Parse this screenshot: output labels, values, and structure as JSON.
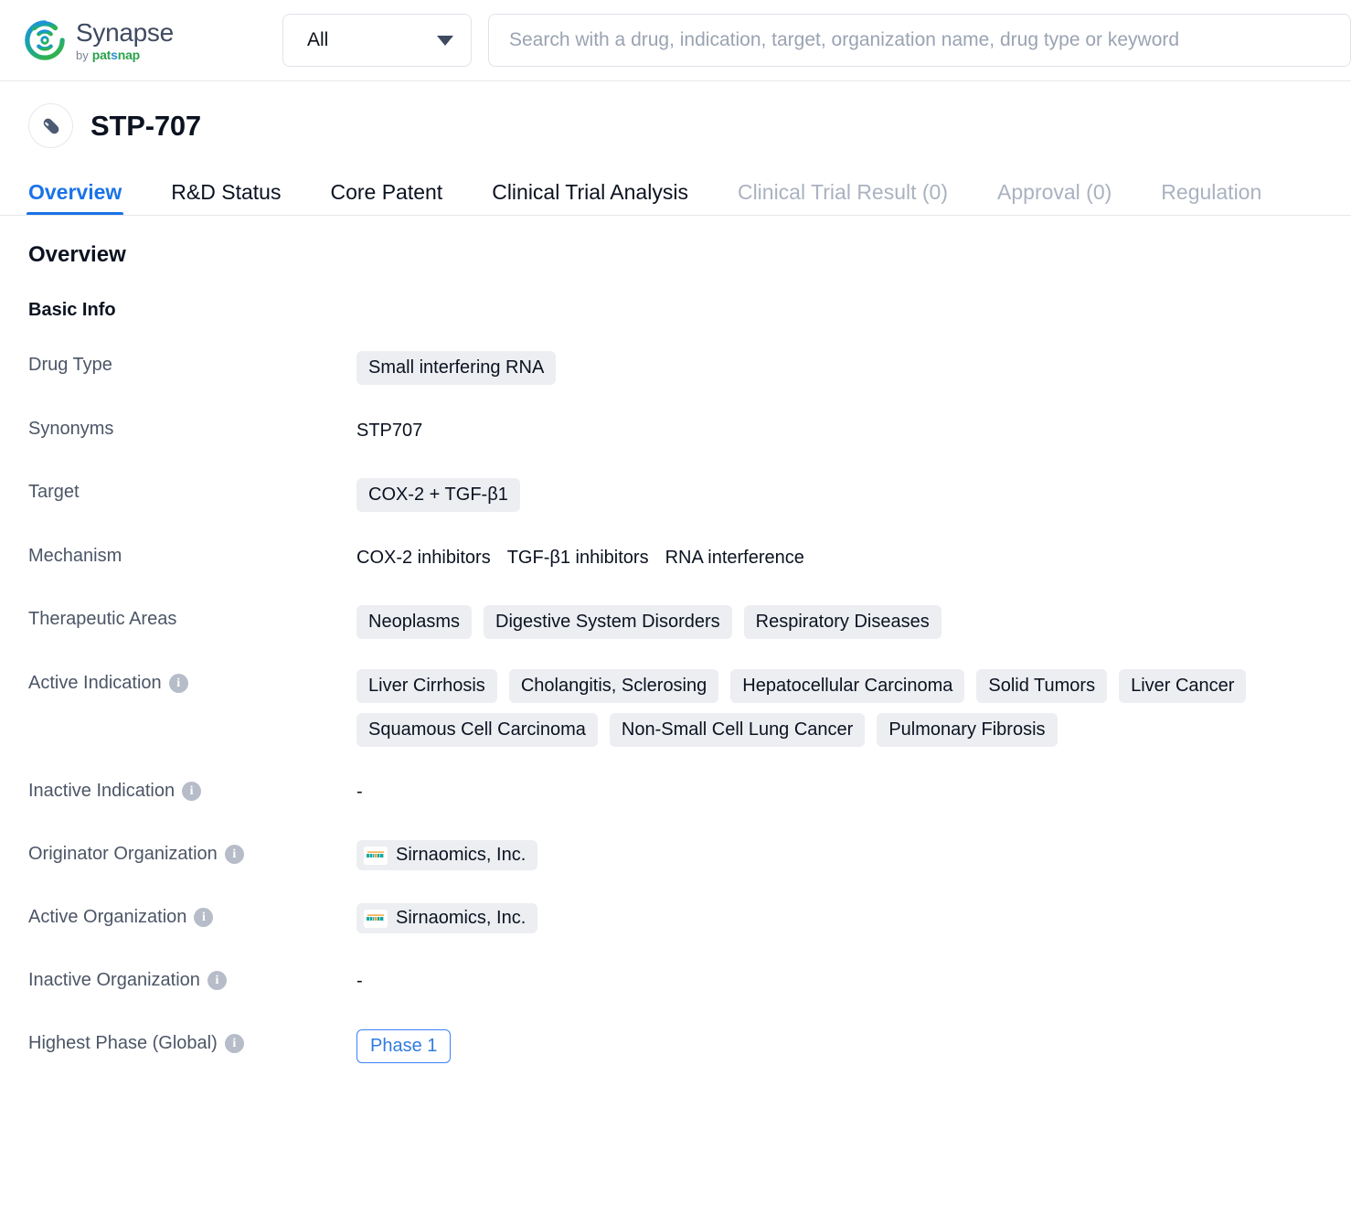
{
  "brand": {
    "name": "Synapse",
    "by": "by",
    "patsnap_a": "pat",
    "patsnap_b": "s",
    "patsnap_c": "nap",
    "logo_icon": "synapse-circular-logo"
  },
  "search": {
    "scope_label": "All",
    "scope_caret_icon": "chevron-down-icon",
    "placeholder": "Search with a drug, indication, target, organization name, drug type or keyword",
    "value": ""
  },
  "drug": {
    "icon": "pill-capsule-icon",
    "name": "STP-707"
  },
  "tabs": [
    {
      "label": "Overview",
      "state": "active"
    },
    {
      "label": "R&D Status",
      "state": "normal"
    },
    {
      "label": "Core Patent",
      "state": "normal"
    },
    {
      "label": "Clinical Trial Analysis",
      "state": "normal"
    },
    {
      "label": "Clinical Trial Result (0)",
      "state": "dim"
    },
    {
      "label": "Approval (0)",
      "state": "dim"
    },
    {
      "label": "Regulation",
      "state": "dim"
    }
  ],
  "overview": {
    "section_title": "Overview",
    "subsection_title": "Basic Info",
    "rows": {
      "drug_type": {
        "label": "Drug Type",
        "chips": [
          "Small interfering RNA"
        ]
      },
      "synonyms": {
        "label": "Synonyms",
        "text": "STP707"
      },
      "target": {
        "label": "Target",
        "chips": [
          "COX-2 + TGF-β1"
        ]
      },
      "mechanism": {
        "label": "Mechanism",
        "items": [
          "COX-2 inhibitors",
          "TGF-β1 inhibitors",
          "RNA interference"
        ]
      },
      "therapeutic_areas": {
        "label": "Therapeutic Areas",
        "chips": [
          "Neoplasms",
          "Digestive System Disorders",
          "Respiratory Diseases"
        ]
      },
      "active_indication": {
        "label": "Active Indication",
        "info_icon": "info-icon",
        "chips": [
          "Liver Cirrhosis",
          "Cholangitis, Sclerosing",
          "Hepatocellular Carcinoma",
          "Solid Tumors",
          "Liver Cancer",
          "Squamous Cell Carcinoma",
          "Non-Small Cell Lung Cancer",
          "Pulmonary Fibrosis"
        ]
      },
      "inactive_indication": {
        "label": "Inactive Indication",
        "info_icon": "info-icon",
        "text": "-"
      },
      "originator_organization": {
        "label": "Originator Organization",
        "info_icon": "info-icon",
        "org_name": "Sirnaomics, Inc.",
        "org_logo_icon": "sirnaomics-logo"
      },
      "active_organization": {
        "label": "Active Organization",
        "info_icon": "info-icon",
        "org_name": "Sirnaomics, Inc.",
        "org_logo_icon": "sirnaomics-logo"
      },
      "inactive_organization": {
        "label": "Inactive Organization",
        "info_icon": "info-icon",
        "text": "-"
      },
      "highest_phase": {
        "label": "Highest Phase (Global)",
        "info_icon": "info-icon",
        "badge": "Phase 1"
      }
    }
  },
  "colors": {
    "accent_blue": "#1a73e8",
    "chip_bg": "#eceef2",
    "label_gray": "#4c5566",
    "dim_tab": "#aab2c0",
    "phase_border": "#3b82f6"
  }
}
